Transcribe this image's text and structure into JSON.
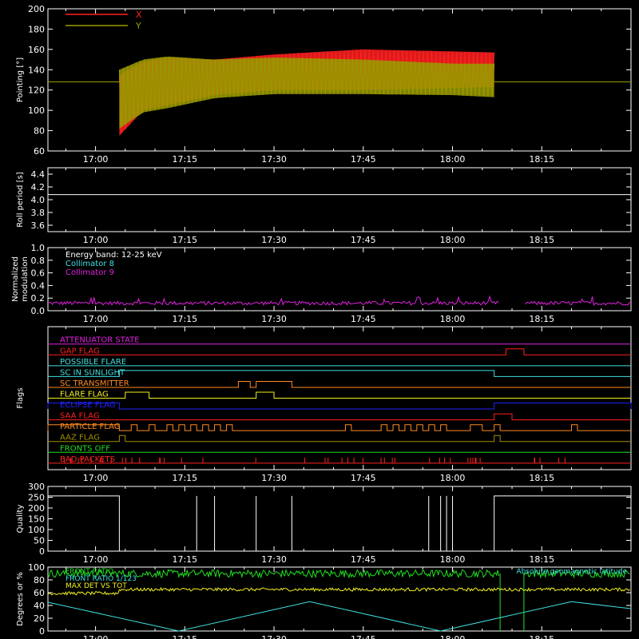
{
  "colors": {
    "background": "#000000",
    "axes": "#ffffff",
    "red": "#ff2020",
    "olive": "#9a9a00",
    "white": "#ffffff",
    "magenta": "#e020e0",
    "cyan": "#40e0e0",
    "orange": "#ff8a20",
    "yellow": "#f0f020",
    "blue": "#2020ff",
    "green": "#20e020",
    "orange2": "#e07020",
    "brown": "#a09000"
  },
  "time_axis": {
    "start": "16:52",
    "end": "18:30",
    "ticks": [
      "17:00",
      "17:15",
      "17:30",
      "17:45",
      "18:00",
      "18:15"
    ]
  },
  "chart_data": [
    {
      "type": "line",
      "panel": "pointing",
      "ylabel": "Pointing [°]",
      "ylim": [
        60,
        200
      ],
      "yticks": [
        60,
        80,
        100,
        120,
        140,
        160,
        180,
        200
      ],
      "legend": [
        "X",
        "Y"
      ],
      "legend_position": "top-left",
      "reference_level": 128,
      "series": [
        {
          "name": "X",
          "color": "red",
          "x": [
            "17:04",
            "17:08",
            "17:12",
            "17:20",
            "17:30",
            "17:45",
            "18:00",
            "18:07"
          ],
          "upper": [
            135,
            148,
            152,
            150,
            155,
            160,
            158,
            157
          ],
          "lower": [
            75,
            100,
            105,
            115,
            120,
            120,
            122,
            123
          ]
        },
        {
          "name": "Y",
          "color": "olive",
          "x": [
            "17:04",
            "17:08",
            "17:12",
            "17:20",
            "17:30",
            "17:45",
            "18:00",
            "18:07"
          ],
          "upper": [
            140,
            150,
            153,
            150,
            152,
            150,
            146,
            146
          ],
          "lower": [
            82,
            98,
            102,
            112,
            116,
            116,
            115,
            113
          ]
        }
      ]
    },
    {
      "type": "line",
      "panel": "roll_period",
      "ylabel": "Roll period [s]",
      "ylim": [
        3.5,
        4.5
      ],
      "yticks": [
        3.6,
        3.8,
        4.0,
        4.2,
        4.4
      ],
      "series": [
        {
          "x": [
            "16:52",
            "18:30"
          ],
          "y": [
            4.08,
            4.08
          ],
          "color": "white"
        }
      ]
    },
    {
      "type": "line",
      "panel": "modulation",
      "ylabel": "Normalized modulation",
      "ylim": [
        0,
        1.0
      ],
      "yticks": [
        0.0,
        0.2,
        0.4,
        0.6,
        0.8,
        1.0
      ],
      "legend": [
        "Energy band: 12-25 keV",
        "Collimator 8",
        "Collimator 9"
      ],
      "series": [
        {
          "name": "Collimator 9",
          "color": "magenta",
          "typical": 0.12,
          "gaps": [
            [
              "18:08",
              "18:12"
            ]
          ]
        }
      ]
    },
    {
      "type": "line",
      "panel": "flags",
      "ylabel": "Flags",
      "flags": [
        {
          "name": "ATTENUATOR STATE",
          "color": "magenta",
          "on": []
        },
        {
          "name": "GAP FLAG",
          "color": "red",
          "on": [
            [
              "18:09",
              "18:12"
            ]
          ]
        },
        {
          "name": "POSSIBLE FLARE",
          "color": "cyan",
          "on": []
        },
        {
          "name": "SC IN SUNLIGHT",
          "color": "cyan",
          "on": [
            [
              "17:04",
              "18:07"
            ]
          ]
        },
        {
          "name": "SC TRANSMITTER",
          "color": "orange",
          "on": [
            [
              "17:24",
              "17:26"
            ],
            [
              "17:27",
              "17:33"
            ]
          ]
        },
        {
          "name": "FLARE FLAG",
          "color": "yellow",
          "on": [
            [
              "17:05",
              "17:09"
            ],
            [
              "17:27",
              "17:30"
            ]
          ]
        },
        {
          "name": "ECLIPSE FLAG",
          "color": "blue",
          "on": [
            [
              "16:52",
              "17:04"
            ],
            [
              "18:07",
              "18:30"
            ]
          ]
        },
        {
          "name": "SAA FLAG",
          "color": "red",
          "on": [
            [
              "18:07",
              "18:10"
            ]
          ]
        },
        {
          "name": "PARTICLE FLAG",
          "color": "orange",
          "on": [
            [
              "16:52",
              "17:04"
            ],
            [
              "17:06",
              "17:07"
            ],
            [
              "17:09",
              "17:10"
            ],
            [
              "17:12",
              "17:13"
            ],
            [
              "17:14",
              "17:15"
            ],
            [
              "17:16",
              "17:17"
            ],
            [
              "17:18",
              "17:19"
            ],
            [
              "17:20",
              "17:21"
            ],
            [
              "17:22",
              "17:23"
            ],
            [
              "17:42",
              "17:43"
            ],
            [
              "17:48",
              "17:49"
            ],
            [
              "17:50",
              "17:51"
            ],
            [
              "17:52",
              "17:53"
            ],
            [
              "17:54",
              "17:55"
            ],
            [
              "17:56",
              "17:57"
            ],
            [
              "17:58",
              "17:59"
            ],
            [
              "18:03",
              "18:05"
            ],
            [
              "18:07",
              "18:08"
            ],
            [
              "18:20",
              "18:21"
            ]
          ]
        },
        {
          "name": "AAZ FLAG",
          "color": "brown",
          "on": [
            [
              "17:04",
              "17:05"
            ],
            [
              "18:07",
              "18:08"
            ]
          ]
        },
        {
          "name": "FRONTS OFF",
          "color": "green",
          "on": []
        },
        {
          "name": "BAD PACKETS",
          "color": "red",
          "on": []
        }
      ]
    },
    {
      "type": "line",
      "panel": "quality",
      "ylabel": "Quality",
      "ylim": [
        0,
        300
      ],
      "yticks": [
        0,
        50,
        100,
        150,
        200,
        250,
        300
      ],
      "series": [
        {
          "color": "white",
          "high": 256,
          "segments_low": [
            [
              "17:04",
              "18:07"
            ]
          ],
          "spikes": [
            "17:17",
            "17:20",
            "17:27",
            "17:33",
            "17:56",
            "17:58",
            "17:59",
            "18:00"
          ]
        }
      ]
    },
    {
      "type": "line",
      "panel": "ratios",
      "ylabel": "Degrees or %",
      "ylim": [
        0,
        100
      ],
      "yticks": [
        0,
        20,
        40,
        60,
        80,
        100
      ],
      "legend": [
        "FRONT RATIO",
        "FRONT RATIO 1/123",
        "MAX DET VS TOT",
        "Absolute geomagnetic latitude"
      ],
      "series": [
        {
          "name": "FRONT RATIO",
          "color": "green",
          "typical": 90
        },
        {
          "name": "MAX DET VS TOT",
          "color": "yellow",
          "typical": 65
        },
        {
          "name": "Absolute geomagnetic latitude",
          "color": "cyan",
          "x": [
            "16:52",
            "17:14",
            "17:36",
            "17:58",
            "18:20",
            "18:30"
          ],
          "y": [
            45,
            0,
            46,
            0,
            46,
            35
          ]
        }
      ]
    }
  ]
}
